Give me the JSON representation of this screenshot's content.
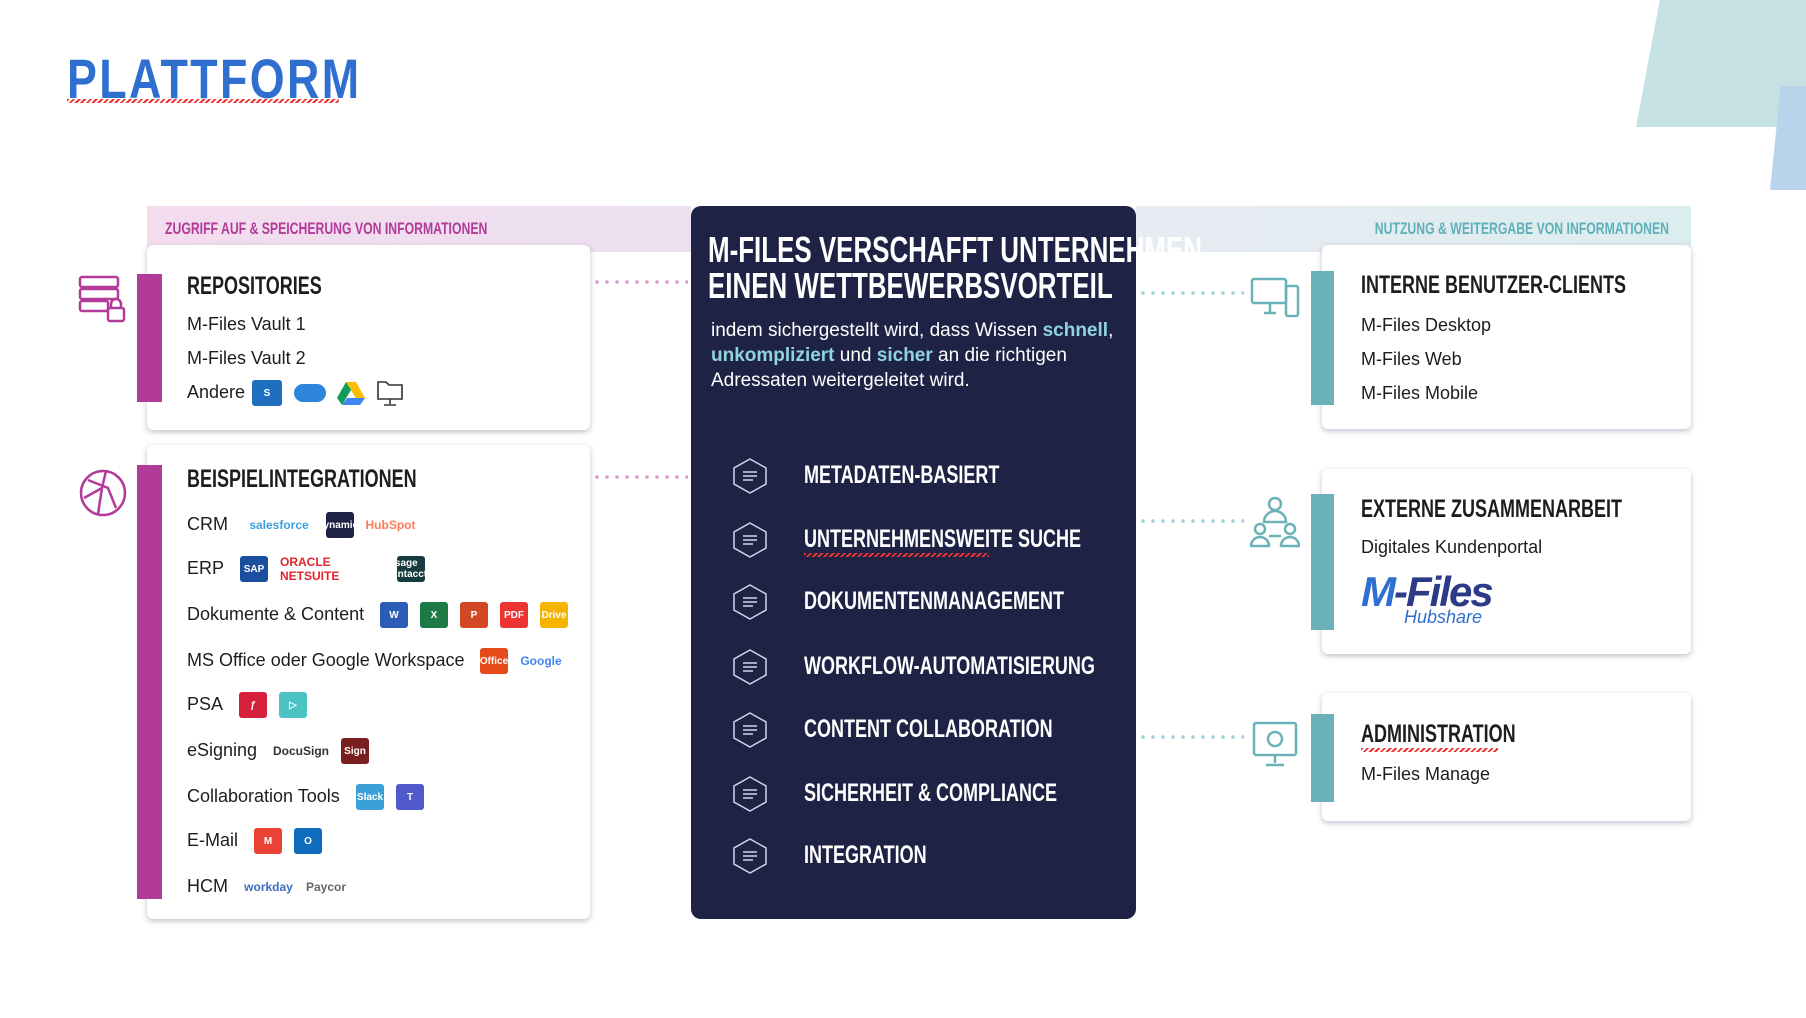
{
  "title": "PLATTFORM",
  "colors": {
    "title": "#2f6fd0",
    "panel": "#1e2245",
    "purple": "#b23a98",
    "teal": "#6ab2b8",
    "highlight": "#8fd3dd"
  },
  "left_band": "ZUGRIFF AUF & SPEICHERUNG VON INFORMATIONEN",
  "right_band": "NUTZUNG & WEITERGABE VON INFORMATIONEN",
  "repositories": {
    "icon": "server-lock-icon",
    "title": "REPOSITORIES",
    "items": [
      "M-Files Vault 1",
      "M-Files Vault 2",
      "Andere"
    ],
    "other_logos": [
      "sharepoint-icon",
      "onedrive-icon",
      "google-drive-icon",
      "network-folder-icon"
    ]
  },
  "integrations": {
    "icon": "globe-network-icon",
    "title": "BEISPIELINTEGRATIONEN",
    "rows": [
      {
        "label": "CRM",
        "logos": [
          "salesforce",
          "Dynamics",
          "HubSpot"
        ]
      },
      {
        "label": "ERP",
        "logos": [
          "SAP",
          "ORACLE NETSUITE",
          "sage intacct"
        ]
      },
      {
        "label": "Dokumente & Content",
        "logos": [
          "W",
          "X",
          "P",
          "PDF",
          "Drive"
        ]
      },
      {
        "label": "MS Office oder Google Workspace",
        "logos": [
          "Office",
          "Google"
        ]
      },
      {
        "label": "PSA",
        "logos": [
          "ƒ",
          "▷"
        ]
      },
      {
        "label": "eSigning",
        "logos": [
          "DocuSign",
          "Sign"
        ]
      },
      {
        "label": "Collaboration Tools",
        "logos": [
          "Slack",
          "T"
        ]
      },
      {
        "label": "E-Mail",
        "logos": [
          "M",
          "O"
        ]
      },
      {
        "label": "HCM",
        "logos": [
          "workday",
          "Paycor"
        ]
      }
    ]
  },
  "center": {
    "title_lines": [
      "M-FILES VERSCHAFFT UNTERNEHMEN",
      "EINEN WETTBEWERBSVORTEIL"
    ],
    "text_1": "indem sichergestellt wird, dass Wissen",
    "hl_1": "schnell",
    "sep_1": ", ",
    "hl_2": "unkompliziert",
    "sep_2": " und ",
    "hl_3": "sicher",
    "text_2": " an die richtigen Adressaten weitergeleitet wird.",
    "features": [
      {
        "icon": "metadata-hexagon-icon",
        "label": "METADATEN-BASIERT"
      },
      {
        "icon": "binoculars-icon",
        "label": "UNTERNEHMENSWEITE SUCHE"
      },
      {
        "icon": "document-star-icon",
        "label": "DOKUMENTENMANAGEMENT"
      },
      {
        "icon": "workflow-gear-icon",
        "label": "WORKFLOW-AUTOMATISIERUNG"
      },
      {
        "icon": "collaboration-edit-icon",
        "label": "CONTENT COLLABORATION"
      },
      {
        "icon": "shield-person-icon",
        "label": "SICHERHEIT & COMPLIANCE"
      },
      {
        "icon": "puzzle-icon",
        "label": "INTEGRATION"
      }
    ]
  },
  "internal": {
    "icon": "desktop-devices-icon",
    "title": "INTERNE BENUTZER-CLIENTS",
    "items": [
      "M-Files Desktop",
      "M-Files Web",
      "M-Files Mobile"
    ]
  },
  "external": {
    "icon": "people-network-icon",
    "title": "EXTERNE ZUSAMMENARBEIT",
    "items": [
      "Digitales Kundenportal"
    ],
    "logo_main": "M-Files",
    "logo_sub": "Hubshare"
  },
  "admin": {
    "icon": "monitor-gear-icon",
    "title": "ADMINISTRATION",
    "items": [
      "M-Files Manage"
    ]
  }
}
